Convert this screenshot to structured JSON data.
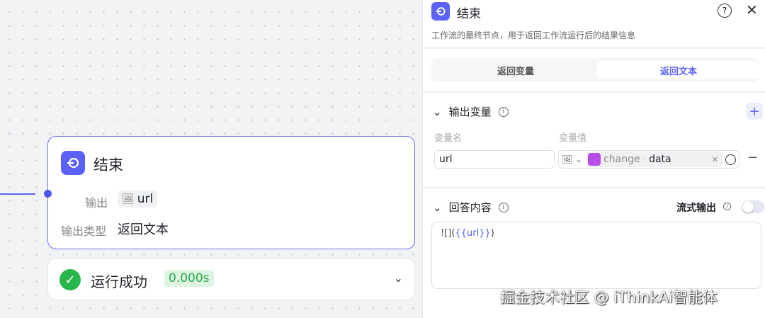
{
  "node": {
    "title": "结束",
    "output_label": "输出",
    "output_value": "url",
    "type_label": "输出类型",
    "type_value": "返回文本"
  },
  "status": {
    "text": "运行成功",
    "time": "0.000s"
  },
  "panel": {
    "title": "结束",
    "description": "工作流的最终节点，用于返回工作流运行后的结果信息",
    "tabs": [
      {
        "label": "返回变量"
      },
      {
        "label": "返回文本"
      }
    ],
    "output_section": {
      "title": "输出变量",
      "name_col": "变量名",
      "value_col": "变量值",
      "name_value": "url",
      "ref_node": "change",
      "ref_var": "data"
    },
    "answer_section": {
      "title": "回答内容",
      "stream_label": "流式输出",
      "content_prefix": "![](",
      "content_var": "{{url}}",
      "content_suffix": ")"
    }
  },
  "watermark": "掘金技术社区 @ iThinkAi智能体",
  "colors": {
    "accent": "#5c62f5",
    "success": "#28b54a"
  }
}
